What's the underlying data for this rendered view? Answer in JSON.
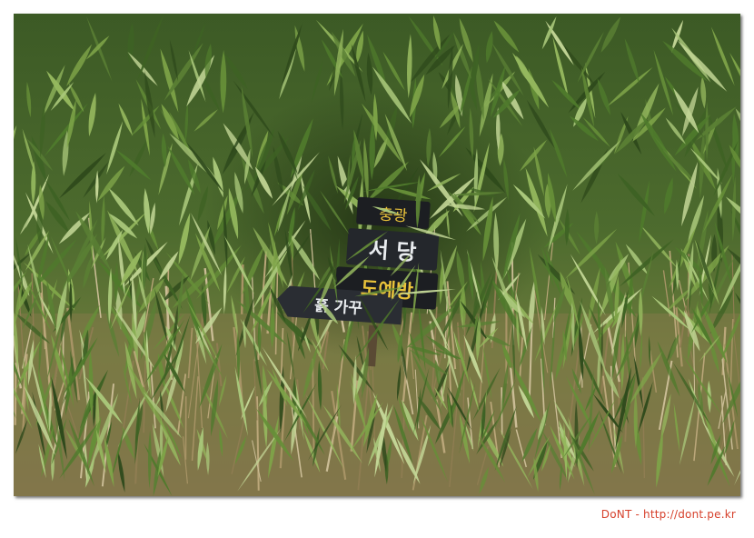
{
  "sign": {
    "line1": "충광",
    "line2": "서 당",
    "line3": "도예방",
    "arrow_text": "흙 가꾸"
  },
  "caption": {
    "text": "DoNT - http://dont.pe.kr"
  },
  "colors": {
    "caption": "#d6402b",
    "sign_board": "#1c1e22",
    "sign_text_white": "#e9ecef",
    "sign_text_yellow": "#e9c23a",
    "foliage_dark": "#2f4a1c",
    "foliage_light": "#a9c77a"
  }
}
